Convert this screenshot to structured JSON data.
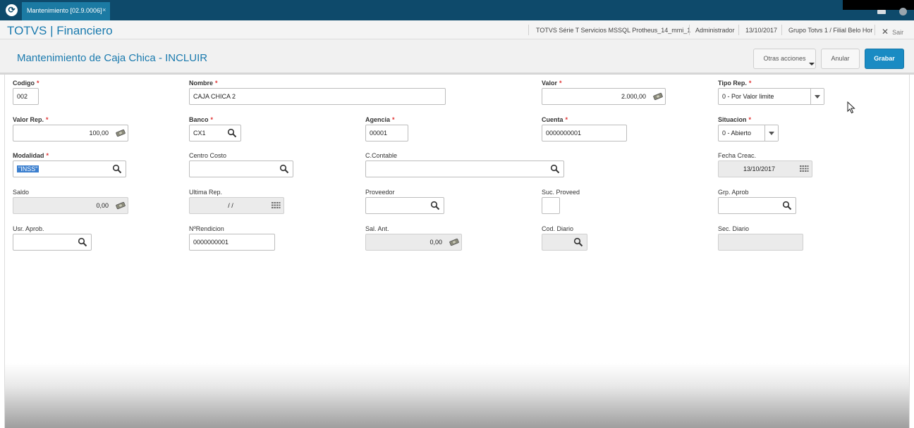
{
  "tab": {
    "label": "Mantenimiento [02.9.0006]",
    "close": "×"
  },
  "header": {
    "app_title": "TOTVS | Financiero",
    "environment": "TOTVS Série T Servicios MSSQL Protheus_14_mmi_1",
    "user": "Administrador",
    "date": "13/10/2017",
    "branch": "Grupo Totvs 1 / Filial Belo Hor",
    "exit": "Sair"
  },
  "page": {
    "title": "Mantenimiento de Caja Chica - INCLUIR"
  },
  "actions": {
    "more": "Otras acciones",
    "cancel": "Anular",
    "save": "Grabar"
  },
  "fields": {
    "codigo": {
      "label": "Codigo",
      "value": "002"
    },
    "nombre": {
      "label": "Nombre",
      "value": "CAJA CHICA 2"
    },
    "valor": {
      "label": "Valor",
      "value": "2.000,00"
    },
    "tipo_rep": {
      "label": "Tipo Rep.",
      "value": "0 - Por Valor limite"
    },
    "valor_rep": {
      "label": "Valor Rep.",
      "value": "100,00"
    },
    "banco": {
      "label": "Banco",
      "value": "CX1"
    },
    "agencia": {
      "label": "Agencia",
      "value": "00001"
    },
    "cuenta": {
      "label": "Cuenta",
      "value": "0000000001"
    },
    "situacion": {
      "label": "Situacion",
      "value": "0 - Abierto"
    },
    "modalidad": {
      "label": "Modalidad",
      "value": "\"INSS\""
    },
    "centro_costo": {
      "label": "Centro Costo",
      "value": ""
    },
    "c_contable": {
      "label": "C.Contable",
      "value": ""
    },
    "fecha_creac": {
      "label": "Fecha Creac.",
      "value": "13/10/2017"
    },
    "saldo": {
      "label": "Saldo",
      "value": "0,00"
    },
    "ultima_rep": {
      "label": "Ultima Rep.",
      "value": "/ /"
    },
    "proveedor": {
      "label": "Proveedor",
      "value": ""
    },
    "suc_proveed": {
      "label": "Suc. Proveed",
      "value": ""
    },
    "grp_aprob": {
      "label": "Grp. Aprob",
      "value": ""
    },
    "usr_aprob": {
      "label": "Usr. Aprob.",
      "value": ""
    },
    "nro_rendicion": {
      "label": "NºRendicion",
      "value": "0000000001"
    },
    "sal_ant": {
      "label": "Sal. Ant.",
      "value": "0,00"
    },
    "cod_diario": {
      "label": "Cod. Diario",
      "value": ""
    },
    "sec_diario": {
      "label": "Sec. Diario",
      "value": ""
    }
  },
  "required_mark": "*",
  "colors": {
    "brand_dark": "#0e4a6b",
    "accent": "#1a7aae",
    "primary_button": "#1a8bc3",
    "required": "#e03030"
  }
}
